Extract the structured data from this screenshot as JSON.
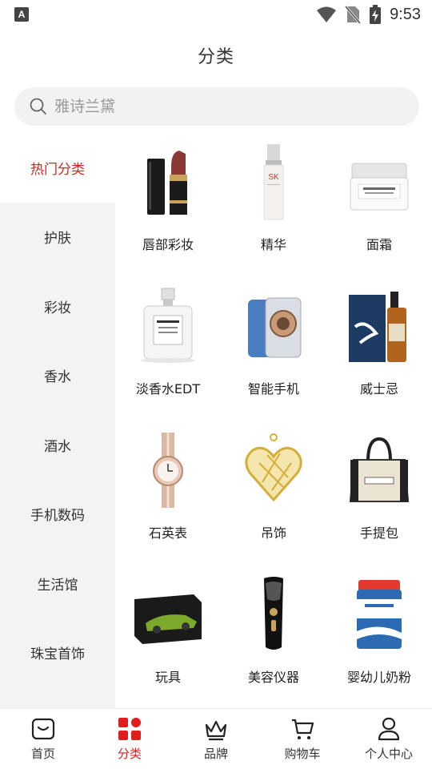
{
  "status_bar": {
    "app_icon_letter": "A",
    "time": "9:53"
  },
  "header": {
    "title": "分类"
  },
  "search": {
    "placeholder": "雅诗兰黛"
  },
  "sidebar": {
    "items": [
      {
        "label": "热门分类",
        "active": true
      },
      {
        "label": "护肤"
      },
      {
        "label": "彩妆"
      },
      {
        "label": "香水"
      },
      {
        "label": "酒水"
      },
      {
        "label": "手机数码"
      },
      {
        "label": "生活馆"
      },
      {
        "label": "珠宝首饰"
      }
    ]
  },
  "categories": [
    {
      "label": "唇部彩妆",
      "icon": "lipstick-image"
    },
    {
      "label": "精华",
      "icon": "essence-bottle-image"
    },
    {
      "label": "面霜",
      "icon": "cream-jar-image"
    },
    {
      "label": "淡香水EDT",
      "icon": "perfume-bottle-image"
    },
    {
      "label": "智能手机",
      "icon": "smartphone-image"
    },
    {
      "label": "威士忌",
      "icon": "whisky-image"
    },
    {
      "label": "石英表",
      "icon": "quartz-watch-image"
    },
    {
      "label": "吊饰",
      "icon": "heart-pendant-image"
    },
    {
      "label": "手提包",
      "icon": "tote-bag-image"
    },
    {
      "label": "玩具",
      "icon": "toy-box-image"
    },
    {
      "label": "美容仪器",
      "icon": "beauty-device-image"
    },
    {
      "label": "婴幼儿奶粉",
      "icon": "milk-powder-image"
    }
  ],
  "bottom_nav": {
    "items": [
      {
        "label": "首页",
        "icon": "home-bag-icon"
      },
      {
        "label": "分类",
        "icon": "grid-icon",
        "active": true
      },
      {
        "label": "品牌",
        "icon": "crown-icon"
      },
      {
        "label": "购物车",
        "icon": "cart-icon"
      },
      {
        "label": "个人中心",
        "icon": "user-icon"
      }
    ]
  },
  "colors": {
    "accent": "#e01e1e",
    "sidebar_bg": "#f3f3f3",
    "search_bg": "#f2f2f2"
  }
}
